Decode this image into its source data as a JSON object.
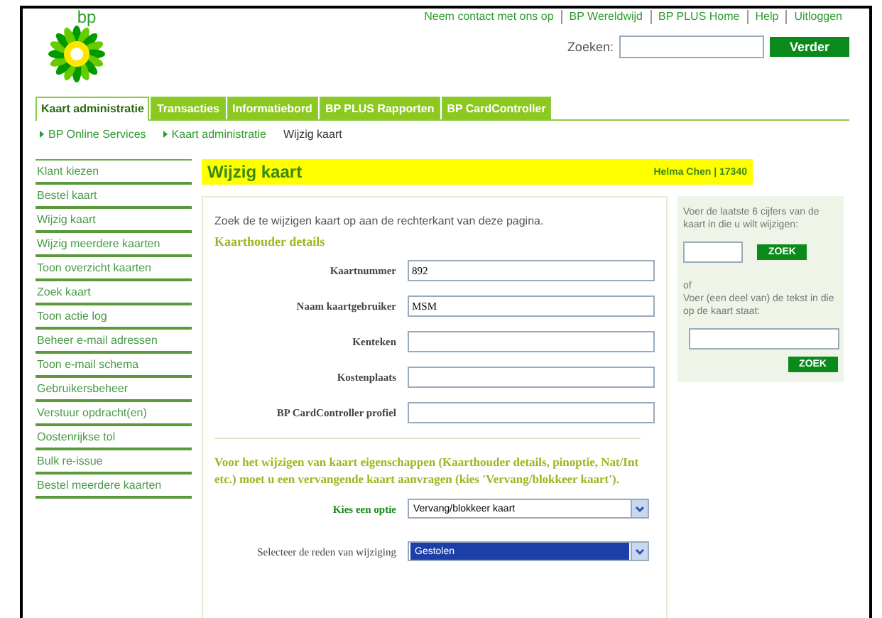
{
  "header": {
    "logo_text": "bp",
    "top_links": [
      "Neem contact met ons op",
      "BP Wereldwijd",
      "BP PLUS Home",
      "Help",
      "Uitloggen"
    ],
    "search": {
      "label": "Zoeken:",
      "button": "Verder"
    }
  },
  "tabs": [
    {
      "label": "Kaart administratie",
      "selected": true
    },
    {
      "label": "Transacties",
      "selected": false
    },
    {
      "label": "Informatiebord",
      "selected": false
    },
    {
      "label": "BP PLUS Rapporten",
      "selected": false
    },
    {
      "label": "BP CardController",
      "selected": false
    }
  ],
  "breadcrumb": [
    {
      "label": "BP Online Services",
      "kind": "link"
    },
    {
      "label": "Kaart administratie",
      "kind": "link"
    },
    {
      "label": "Wijzig kaart",
      "kind": "current"
    }
  ],
  "sidebar": {
    "items": [
      "Klant kiezen",
      "Bestel kaart",
      "Wijzig kaart",
      "Wijzig meerdere kaarten",
      "Toon overzicht kaarten",
      "Zoek kaart",
      "Toon actie log",
      "Beheer e-mail adressen",
      "Toon e-mail schema",
      "Gebruikersbeheer",
      "Verstuur opdracht(en)",
      "Oostenrijkse tol",
      "Bulk re-issue",
      "Bestel meerdere kaarten"
    ]
  },
  "main": {
    "title": "Wijzig kaart",
    "user": "Helma Chen | 17340",
    "intro": "Zoek de te wijzigen kaart op aan de rechterkant van deze pagina.",
    "section_title": "Kaarthouder details",
    "fields": [
      {
        "label": "Kaartnummer",
        "value": "892"
      },
      {
        "label": "Naam kaartgebruiker",
        "value": "MSM"
      },
      {
        "label": "Kenteken"
      },
      {
        "label": "Kostenplaats"
      },
      {
        "label": "BP CardController profiel"
      }
    ],
    "notice": "Voor het wijzigen van kaart eigenschappen (Kaarthouder details, pinoptie, Nat/Int etc.) moet u een vervangende kaart aanvragen (kies 'Vervang/blokkeer kaart').",
    "selects": [
      {
        "label": "Kies een optie",
        "value": "Vervang/blokkeer kaart",
        "highlighted": false,
        "kind": "green"
      },
      {
        "label": "Selecteer de reden van wijziging",
        "value": "Gestolen",
        "highlighted": true,
        "kind": "plain"
      }
    ]
  },
  "search_panel": {
    "instruction1": "Voer de laatste 6 cijfers van de kaart in die u wilt wijzigen:",
    "button1": "ZOEK",
    "or": "of",
    "instruction2": "Voer (een deel van) de tekst in die op de kaart staat:",
    "button2": "ZOEK"
  }
}
